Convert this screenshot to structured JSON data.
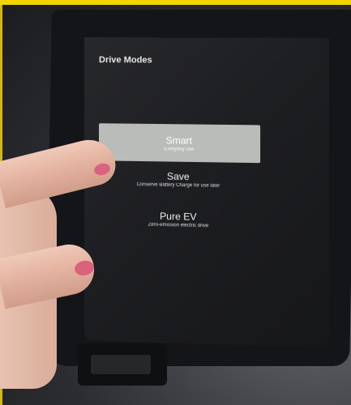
{
  "screen": {
    "title": "Drive Modes",
    "modes": [
      {
        "name": "Smart",
        "description": "Everyday use",
        "selected": true
      },
      {
        "name": "Save",
        "description": "Conserve Battery Charge for use later",
        "selected": false
      },
      {
        "name": "Pure EV",
        "description": "Zero-emission electric drive",
        "selected": false
      }
    ]
  },
  "colors": {
    "highlight": "#b9bcb9",
    "screen_bg": "#1d1e21",
    "frame_accent": "#f2d500",
    "nail": "#d9637c"
  }
}
